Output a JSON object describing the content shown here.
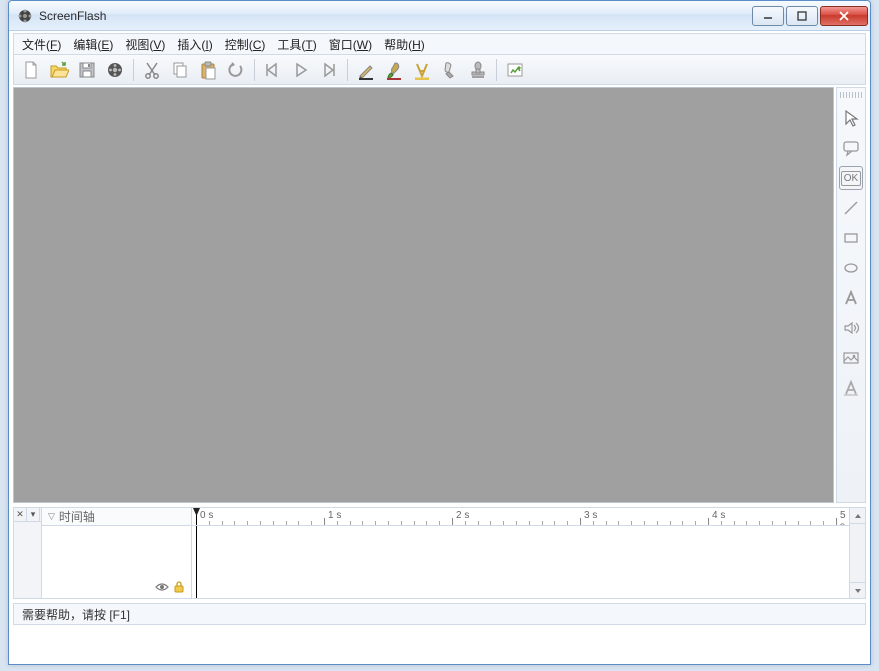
{
  "app": {
    "title": "ScreenFlash"
  },
  "menu": {
    "items": [
      {
        "label": "文件",
        "accel": "F"
      },
      {
        "label": "编辑",
        "accel": "E"
      },
      {
        "label": "视图",
        "accel": "V"
      },
      {
        "label": "插入",
        "accel": "I"
      },
      {
        "label": "控制",
        "accel": "C"
      },
      {
        "label": "工具",
        "accel": "T"
      },
      {
        "label": "窗口",
        "accel": "W"
      },
      {
        "label": "帮助",
        "accel": "H"
      }
    ]
  },
  "toolbar": {
    "buttons": [
      "new-file",
      "open-file",
      "save",
      "record",
      "sep",
      "cut",
      "copy",
      "paste",
      "undo",
      "sep",
      "prev-frame",
      "play",
      "next-frame",
      "sep",
      "pencil",
      "brush",
      "highlight",
      "eraser",
      "stamp",
      "sep",
      "properties"
    ]
  },
  "side_tools": [
    "pointer",
    "callout",
    "ok-button",
    "line",
    "rectangle",
    "ellipse",
    "text",
    "sound",
    "image",
    "text-annotation"
  ],
  "ok_label": "OK",
  "timeline": {
    "label": "时间轴",
    "seconds": [
      0,
      1,
      2,
      3,
      4,
      5
    ],
    "unit": "s",
    "pixels_per_second": 128,
    "playhead_time": 0,
    "minor_ticks_per_second": 10
  },
  "status": {
    "text": "需要帮助，请按 [F1]"
  }
}
